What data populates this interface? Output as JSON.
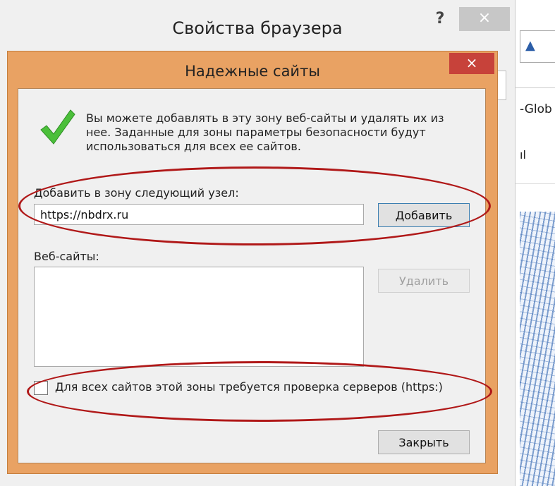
{
  "background_window": {
    "title": "Свойства браузера",
    "help_symbol": "?",
    "close_symbol": "×"
  },
  "browser_strip": {
    "tab_text": "-Glob",
    "text_fragment": "ıl"
  },
  "dialog": {
    "title": "Надежные сайты",
    "close_symbol": "×",
    "info_text": "Вы можете добавлять в эту зону веб-сайты и удалять их из нее. Заданные для зоны параметры безопасности будут использоваться для всех ее сайтов.",
    "add_label": "Добавить в зону следующий узел:",
    "url_value": "https://nbdrx.ru",
    "add_button": "Добавить",
    "websites_label": "Веб-сайты:",
    "websites": [],
    "delete_button": "Удалить",
    "https_checkbox_label": "Для всех сайтов этой зоны требуется проверка серверов (https:)",
    "https_checked": false,
    "close_button": "Закрыть"
  },
  "colors": {
    "dialog_frame": "#e9a263",
    "close_button": "#c7423a",
    "annotation": "#b01818",
    "checkmark": "#4bbf3a"
  },
  "icons": {
    "dialog_icon": "green-checkmark-icon"
  }
}
